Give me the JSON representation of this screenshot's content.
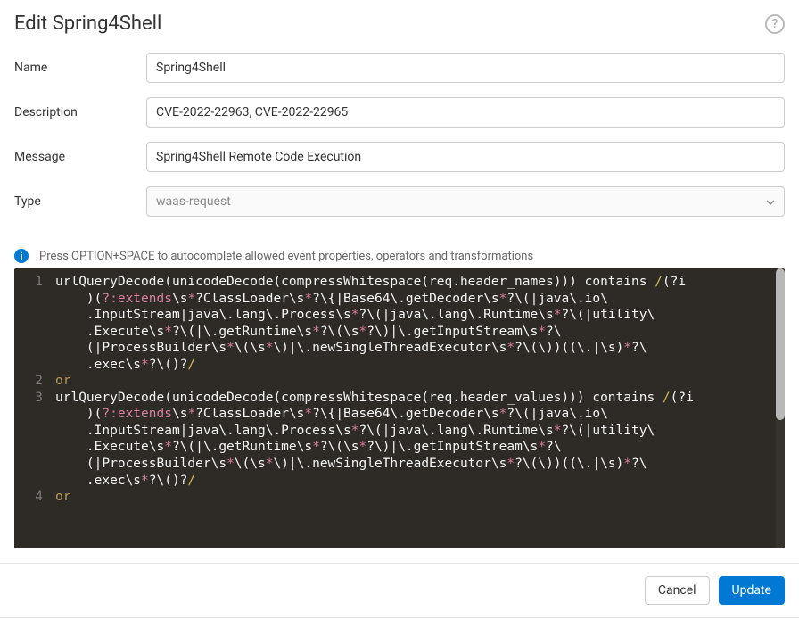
{
  "header": {
    "title": "Edit Spring4Shell"
  },
  "form": {
    "name_label": "Name",
    "name_value": "Spring4Shell",
    "description_label": "Description",
    "description_value": "CVE-2022-22963, CVE-2022-22965",
    "message_label": "Message",
    "message_value": "Spring4Shell Remote Code Execution",
    "type_label": "Type",
    "type_value": "waas-request"
  },
  "hint": "Press OPTION+SPACE to autocomplete allowed event properties, operators and transformations",
  "editor": {
    "line_numbers": [
      "1",
      "",
      "",
      "",
      "",
      "2",
      "3",
      "",
      "",
      "",
      "",
      "4"
    ],
    "lines": [
      {
        "segments": [
          {
            "t": "urlQueryDecode(unicodeDecode(compressWhitespace(req.header_names))) contains ",
            "c": "tok-fn"
          },
          {
            "t": "/",
            "c": "tok-regex"
          },
          {
            "t": "(?i",
            "c": "tok-plain"
          }
        ]
      },
      {
        "segments": [
          {
            "t": "    )(",
            "c": "tok-plain"
          },
          {
            "t": "?:extends",
            "c": "tok-kw"
          },
          {
            "t": "\\s",
            "c": "tok-plain"
          },
          {
            "t": "*",
            "c": "tok-op"
          },
          {
            "t": "?ClassLoader\\s",
            "c": "tok-plain"
          },
          {
            "t": "*",
            "c": "tok-op"
          },
          {
            "t": "?\\{|Base64\\.getDecoder\\s",
            "c": "tok-plain"
          },
          {
            "t": "*",
            "c": "tok-op"
          },
          {
            "t": "?\\(|java\\.io\\",
            "c": "tok-plain"
          }
        ]
      },
      {
        "segments": [
          {
            "t": "    .InputStream|java\\.lang\\.Process\\s",
            "c": "tok-plain"
          },
          {
            "t": "*",
            "c": "tok-op"
          },
          {
            "t": "?\\(|java\\.lang\\.Runtime\\s",
            "c": "tok-plain"
          },
          {
            "t": "*",
            "c": "tok-op"
          },
          {
            "t": "?\\(|utility\\",
            "c": "tok-plain"
          }
        ]
      },
      {
        "segments": [
          {
            "t": "    .Execute\\s",
            "c": "tok-plain"
          },
          {
            "t": "*",
            "c": "tok-op"
          },
          {
            "t": "?\\(|\\.getRuntime\\s",
            "c": "tok-plain"
          },
          {
            "t": "*",
            "c": "tok-op"
          },
          {
            "t": "?\\(\\s",
            "c": "tok-plain"
          },
          {
            "t": "*",
            "c": "tok-op"
          },
          {
            "t": "?\\)|\\.getInputStream\\s",
            "c": "tok-plain"
          },
          {
            "t": "*",
            "c": "tok-op"
          },
          {
            "t": "?\\",
            "c": "tok-plain"
          }
        ]
      },
      {
        "segments": [
          {
            "t": "    (|ProcessBuilder\\s",
            "c": "tok-plain"
          },
          {
            "t": "*",
            "c": "tok-op"
          },
          {
            "t": "\\(\\s",
            "c": "tok-plain"
          },
          {
            "t": "*",
            "c": "tok-op"
          },
          {
            "t": "\\)|\\.newSingleThreadExecutor\\s",
            "c": "tok-plain"
          },
          {
            "t": "*",
            "c": "tok-op"
          },
          {
            "t": "?\\(\\))((\\.|\\s)",
            "c": "tok-plain"
          },
          {
            "t": "*",
            "c": "tok-op"
          },
          {
            "t": "?\\",
            "c": "tok-plain"
          }
        ]
      },
      {
        "segments": [
          {
            "t": "    .exec\\s",
            "c": "tok-plain"
          },
          {
            "t": "*",
            "c": "tok-op"
          },
          {
            "t": "?\\()?",
            "c": "tok-plain"
          },
          {
            "t": "/",
            "c": "tok-regex"
          }
        ]
      },
      {
        "segments": [
          {
            "t": "or",
            "c": "tok-or"
          }
        ]
      },
      {
        "segments": [
          {
            "t": "urlQueryDecode(unicodeDecode(compressWhitespace(req.header_values))) contains ",
            "c": "tok-fn"
          },
          {
            "t": "/",
            "c": "tok-regex"
          },
          {
            "t": "(?i",
            "c": "tok-plain"
          }
        ]
      },
      {
        "segments": [
          {
            "t": "    )(",
            "c": "tok-plain"
          },
          {
            "t": "?:extends",
            "c": "tok-kw"
          },
          {
            "t": "\\s",
            "c": "tok-plain"
          },
          {
            "t": "*",
            "c": "tok-op"
          },
          {
            "t": "?ClassLoader\\s",
            "c": "tok-plain"
          },
          {
            "t": "*",
            "c": "tok-op"
          },
          {
            "t": "?\\{|Base64\\.getDecoder\\s",
            "c": "tok-plain"
          },
          {
            "t": "*",
            "c": "tok-op"
          },
          {
            "t": "?\\(|java\\.io\\",
            "c": "tok-plain"
          }
        ]
      },
      {
        "segments": [
          {
            "t": "    .InputStream|java\\.lang\\.Process\\s",
            "c": "tok-plain"
          },
          {
            "t": "*",
            "c": "tok-op"
          },
          {
            "t": "?\\(|java\\.lang\\.Runtime\\s",
            "c": "tok-plain"
          },
          {
            "t": "*",
            "c": "tok-op"
          },
          {
            "t": "?\\(|utility\\",
            "c": "tok-plain"
          }
        ]
      },
      {
        "segments": [
          {
            "t": "    .Execute\\s",
            "c": "tok-plain"
          },
          {
            "t": "*",
            "c": "tok-op"
          },
          {
            "t": "?\\(|\\.getRuntime\\s",
            "c": "tok-plain"
          },
          {
            "t": "*",
            "c": "tok-op"
          },
          {
            "t": "?\\(\\s",
            "c": "tok-plain"
          },
          {
            "t": "*",
            "c": "tok-op"
          },
          {
            "t": "?\\)|\\.getInputStream\\s",
            "c": "tok-plain"
          },
          {
            "t": "*",
            "c": "tok-op"
          },
          {
            "t": "?\\",
            "c": "tok-plain"
          }
        ]
      },
      {
        "segments": [
          {
            "t": "    (|ProcessBuilder\\s",
            "c": "tok-plain"
          },
          {
            "t": "*",
            "c": "tok-op"
          },
          {
            "t": "\\(\\s",
            "c": "tok-plain"
          },
          {
            "t": "*",
            "c": "tok-op"
          },
          {
            "t": "\\)|\\.newSingleThreadExecutor\\s",
            "c": "tok-plain"
          },
          {
            "t": "*",
            "c": "tok-op"
          },
          {
            "t": "?\\(\\))((\\.|\\s)",
            "c": "tok-plain"
          },
          {
            "t": "*",
            "c": "tok-op"
          },
          {
            "t": "?\\",
            "c": "tok-plain"
          }
        ]
      },
      {
        "segments": [
          {
            "t": "    .exec\\s",
            "c": "tok-plain"
          },
          {
            "t": "*",
            "c": "tok-op"
          },
          {
            "t": "?\\()?",
            "c": "tok-plain"
          },
          {
            "t": "/",
            "c": "tok-regex"
          }
        ]
      },
      {
        "segments": [
          {
            "t": "or",
            "c": "tok-or"
          }
        ]
      }
    ]
  },
  "footer": {
    "cancel_label": "Cancel",
    "update_label": "Update"
  }
}
